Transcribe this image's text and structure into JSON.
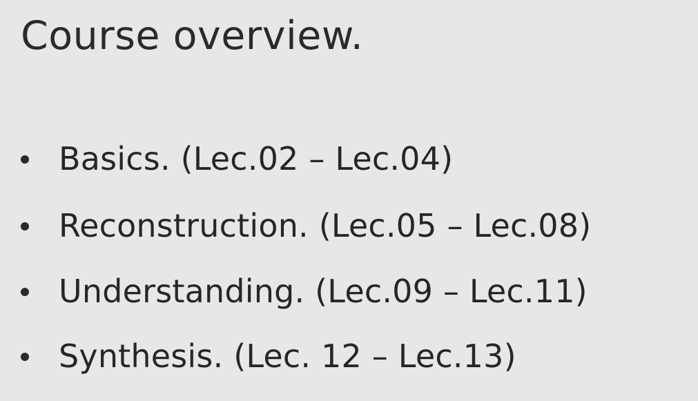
{
  "slide": {
    "title": "Course overview.",
    "bullets": [
      "Basics. (Lec.02 – Lec.04)",
      "Reconstruction.  (Lec.05 – Lec.08)",
      "Understanding. (Lec.09 – Lec.11)",
      "Synthesis. (Lec. 12 – Lec.13)"
    ]
  },
  "colors": {
    "background": "#e7e7e7",
    "text": "#262626"
  }
}
